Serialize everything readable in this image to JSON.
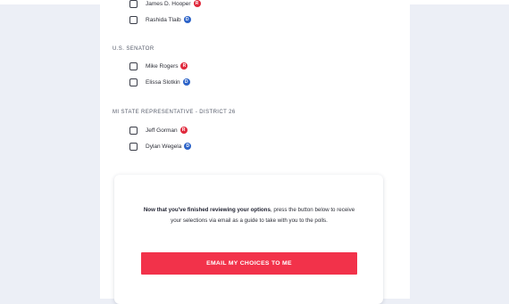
{
  "races": [
    {
      "title": "",
      "candidates": [
        {
          "name": "James D. Hooper",
          "party": "R",
          "party_color": "#e0283b"
        },
        {
          "name": "Rashida Tlaib",
          "party": "D",
          "party_color": "#2c63c8"
        }
      ]
    },
    {
      "title": "U.S. SENATOR",
      "candidates": [
        {
          "name": "Mike Rogers",
          "party": "R",
          "party_color": "#e0283b"
        },
        {
          "name": "Elissa Slotkin",
          "party": "D",
          "party_color": "#2c63c8"
        }
      ]
    },
    {
      "title": "MI STATE REPRESENTATIVE - DISTRICT 26",
      "candidates": [
        {
          "name": "Jeff Gorman",
          "party": "R",
          "party_color": "#e0283b"
        },
        {
          "name": "Dylan Wegela",
          "party": "D",
          "party_color": "#2c63c8"
        }
      ]
    }
  ],
  "cta": {
    "text_bold": "Now that you've finished reviewing your options",
    "text_rest": ", press the button below to receive your selections via email as a guide to take with you to the polls.",
    "button_label": "EMAIL MY CHOICES TO ME",
    "button_color": "#f2324a"
  }
}
